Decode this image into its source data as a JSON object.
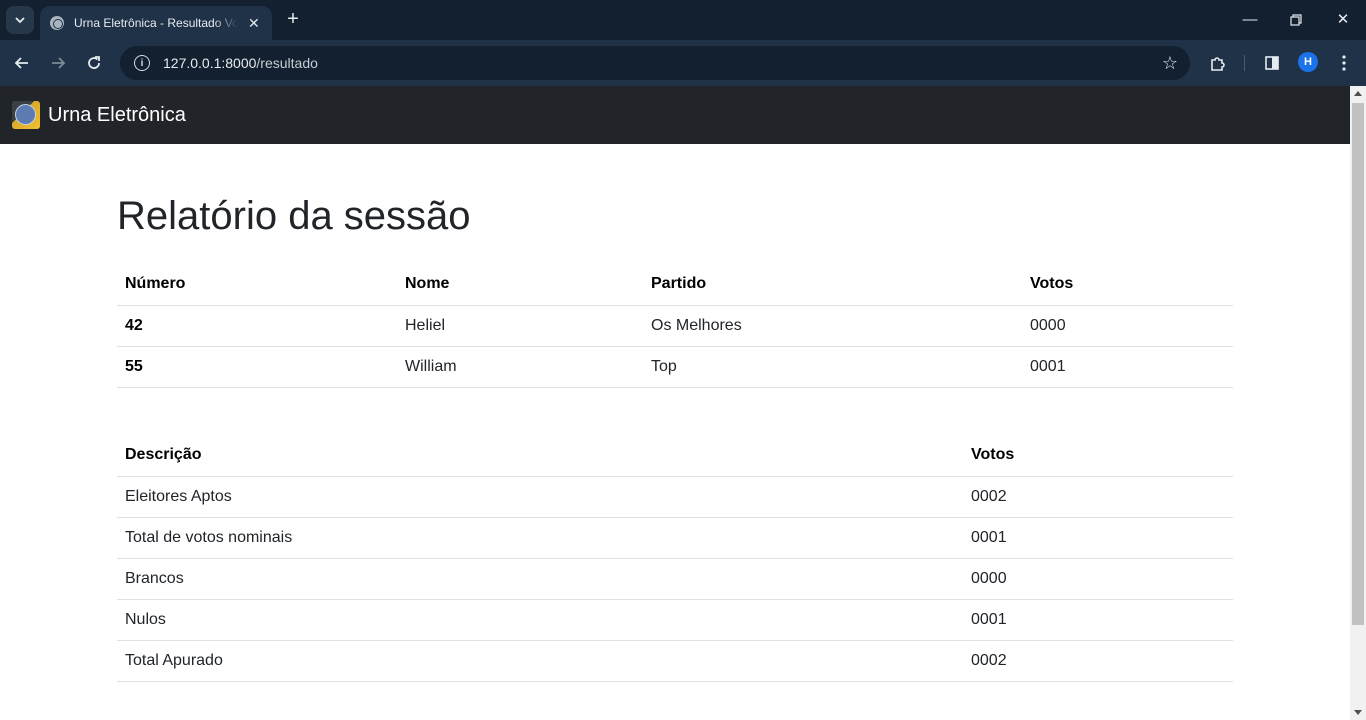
{
  "browser": {
    "tab_title": "Urna Eletrônica - Resultado Votação",
    "url_host": "127.0.0.1:8000",
    "url_path": "/resultado",
    "profile_initial": "H"
  },
  "navbar": {
    "brand": "Urna Eletrônica"
  },
  "page": {
    "title": "Relatório da sessão"
  },
  "candidates_table": {
    "headers": [
      "Número",
      "Nome",
      "Partido",
      "Votos"
    ],
    "rows": [
      {
        "numero": "42",
        "nome": "Heliel",
        "partido": "Os Melhores",
        "votos": "0000"
      },
      {
        "numero": "55",
        "nome": "William",
        "partido": "Top",
        "votos": "0001"
      }
    ]
  },
  "summary_table": {
    "headers": [
      "Descrição",
      "Votos"
    ],
    "rows": [
      {
        "descricao": "Eleitores Aptos",
        "votos": "0002"
      },
      {
        "descricao": "Total de votos nominais",
        "votos": "0001"
      },
      {
        "descricao": "Brancos",
        "votos": "0000"
      },
      {
        "descricao": "Nulos",
        "votos": "0001"
      },
      {
        "descricao": "Total Apurado",
        "votos": "0002"
      }
    ]
  },
  "colors": {
    "navbar_bg": "#212529",
    "chrome_bg": "#1f3247",
    "text": "#212529",
    "border": "#dee2e6"
  }
}
